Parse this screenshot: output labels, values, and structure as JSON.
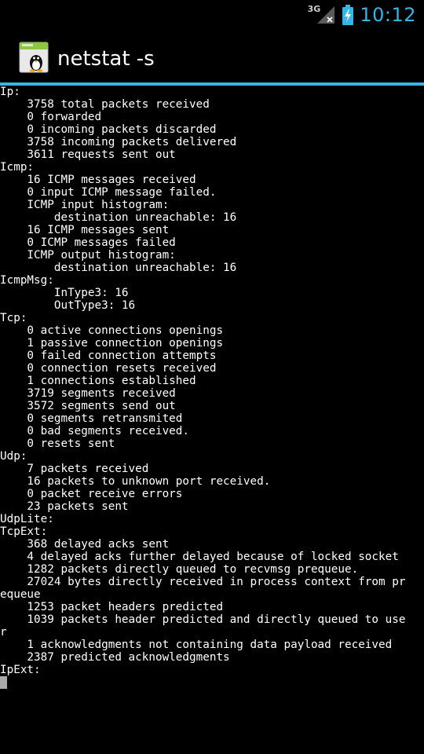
{
  "status_bar": {
    "network_type": "3G",
    "signal_icon": "signal-no-data-icon",
    "battery_icon": "battery-charging-icon",
    "time": "10:12",
    "accent_color": "#33b5e5"
  },
  "action_bar": {
    "app_icon": "android-terminal-app-icon",
    "title": "netstat -s"
  },
  "terminal": {
    "lines": [
      "Ip:",
      "    3758 total packets received",
      "    0 forwarded",
      "    0 incoming packets discarded",
      "    3758 incoming packets delivered",
      "    3611 requests sent out",
      "Icmp:",
      "    16 ICMP messages received",
      "    0 input ICMP message failed.",
      "    ICMP input histogram:",
      "        destination unreachable: 16",
      "    16 ICMP messages sent",
      "    0 ICMP messages failed",
      "    ICMP output histogram:",
      "        destination unreachable: 16",
      "IcmpMsg:",
      "        InType3: 16",
      "        OutType3: 16",
      "Tcp:",
      "    0 active connections openings",
      "    1 passive connection openings",
      "    0 failed connection attempts",
      "    0 connection resets received",
      "    1 connections established",
      "    3719 segments received",
      "    3572 segments send out",
      "    0 segments retransmited",
      "    0 bad segments received.",
      "    0 resets sent",
      "Udp:",
      "    7 packets received",
      "    16 packets to unknown port received.",
      "    0 packet receive errors",
      "    23 packets sent",
      "UdpLite:",
      "TcpExt:",
      "    368 delayed acks sent",
      "    4 delayed acks further delayed because of locked socket",
      "    1282 packets directly queued to recvmsg prequeue.",
      "    27024 bytes directly received in process context from pr",
      "equeue",
      "    1253 packet headers predicted",
      "    1039 packets header predicted and directly queued to use",
      "r",
      "    1 acknowledgments not containing data payload received",
      "    2387 predicted acknowledgments",
      "IpExt:"
    ]
  }
}
